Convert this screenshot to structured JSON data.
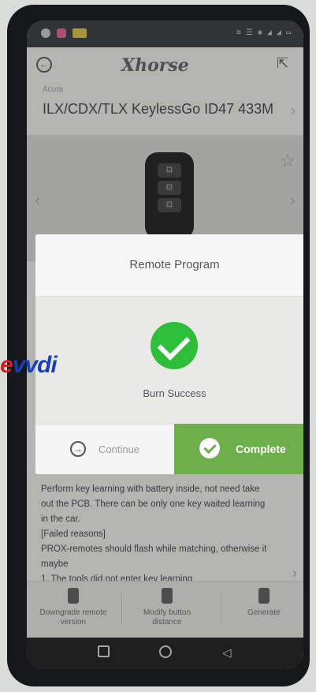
{
  "statusbar": {
    "right_text": "≋ ☰ ✱ ◢ ◢ ▭"
  },
  "appbar": {
    "back_icon": "back-icon",
    "brand": "Xhorse",
    "share_icon": "share-icon"
  },
  "breadcrumb": "Acura",
  "title": "ILX/CDX/TLX KeylessGo ID47 433M",
  "keyfob": {
    "buttons": [
      "⊡",
      "⊡",
      "⊡"
    ]
  },
  "description": {
    "lines": [
      "Perform key learning with battery inside, not need take",
      "out the PCB. There can be only one key waited learning",
      "in the car.",
      "[Failed reasons]",
      "PROX-remotes should flash while matching, otherwise it",
      "maybe",
      "1. The tools did not enter key learning"
    ]
  },
  "toolbar": {
    "items": [
      {
        "label": "Downgrade remote version"
      },
      {
        "label": "Modify button distance"
      },
      {
        "label": "Generate"
      }
    ]
  },
  "dialog": {
    "title": "Remote Program",
    "message": "Burn Success",
    "continue_label": "Continue",
    "complete_label": "Complete"
  },
  "watermark": {
    "prefix": "e",
    "rest": "vvdi"
  }
}
